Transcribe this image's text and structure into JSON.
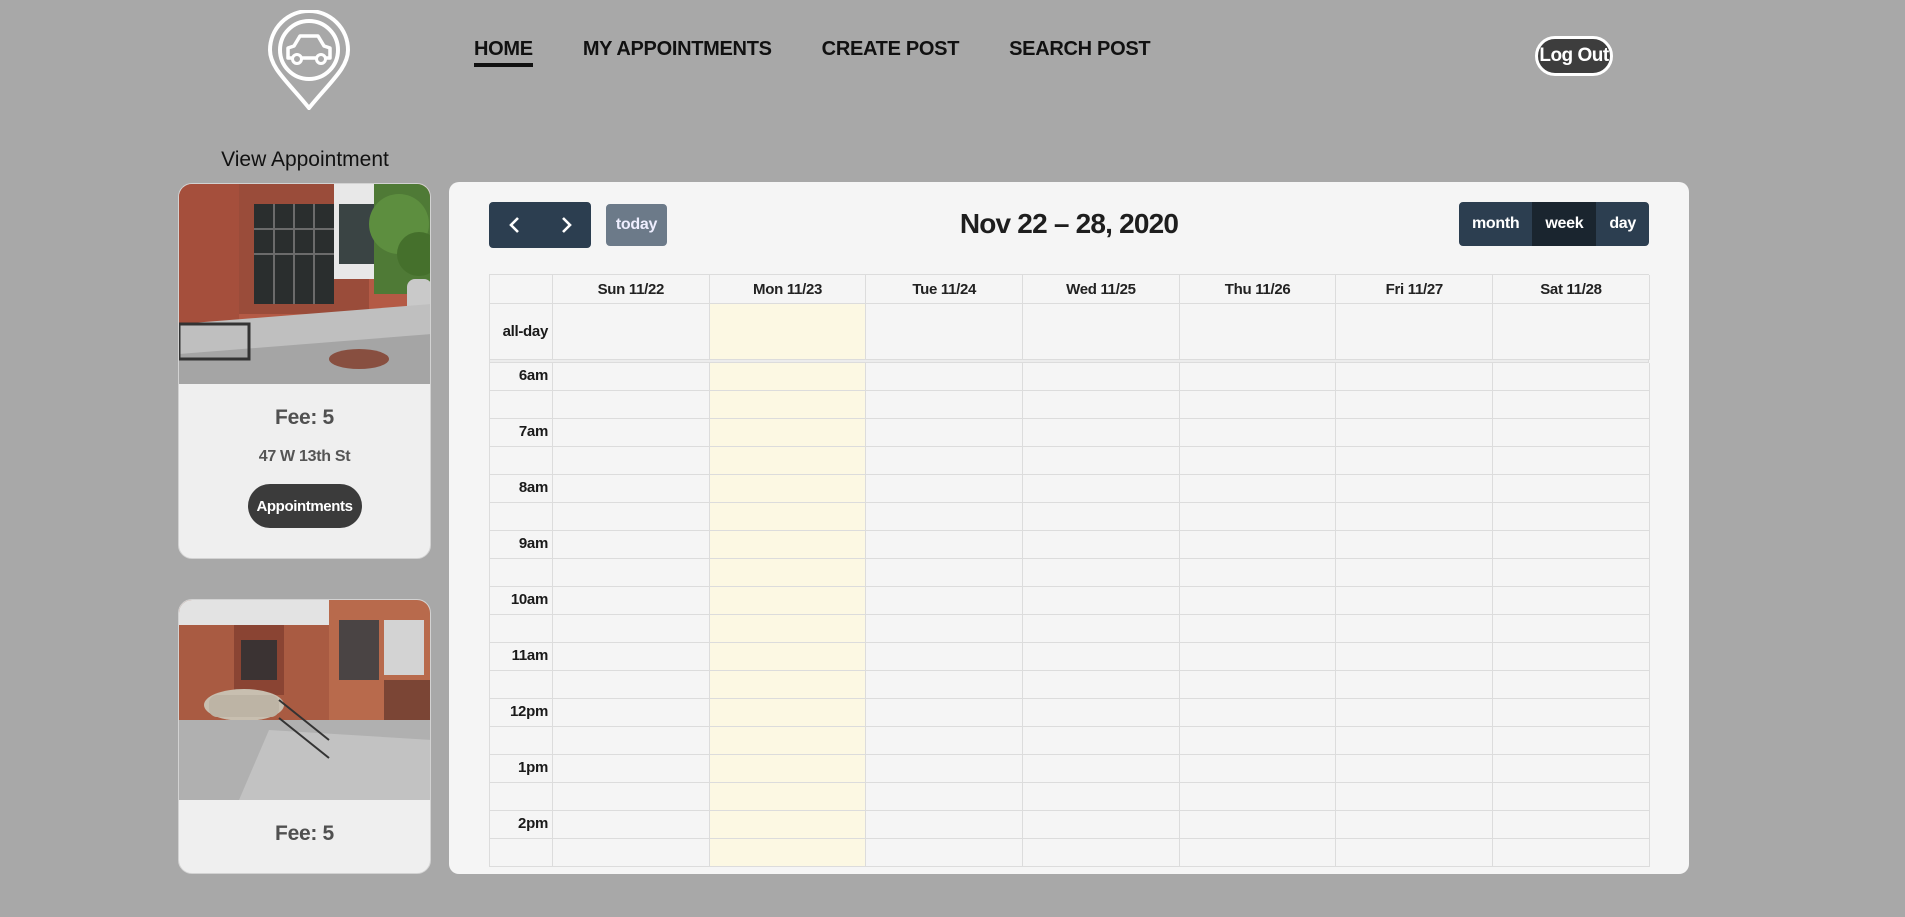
{
  "header": {
    "nav": [
      {
        "label": "HOME",
        "active": true
      },
      {
        "label": "MY APPOINTMENTS",
        "active": false
      },
      {
        "label": "CREATE POST",
        "active": false
      },
      {
        "label": "SEARCH POST",
        "active": false
      }
    ],
    "logout_label": "Log Out",
    "logo_icon": "car-location-pin-icon"
  },
  "sidebar": {
    "title": "View Appointment",
    "cards": [
      {
        "fee": "Fee: 5",
        "address": "47 W 13th St",
        "button": "Appointments"
      },
      {
        "fee": "Fee: 5",
        "address": "",
        "button": ""
      }
    ]
  },
  "calendar": {
    "title": "Nov 22 – 28, 2020",
    "prev_icon": "chevron-left-icon",
    "next_icon": "chevron-right-icon",
    "today_label": "today",
    "views": [
      {
        "label": "month",
        "active": false
      },
      {
        "label": "week",
        "active": true
      },
      {
        "label": "day",
        "active": false
      }
    ],
    "days": [
      "Sun 11/22",
      "Mon 11/23",
      "Tue 11/24",
      "Wed 11/25",
      "Thu 11/26",
      "Fri 11/27",
      "Sat 11/28"
    ],
    "today_index": 1,
    "allday_label": "all-day",
    "hours": [
      "6am",
      "7am",
      "8am",
      "9am",
      "10am",
      "11am",
      "12pm",
      "1pm",
      "2pm"
    ]
  },
  "colors": {
    "background": "#a8a8a8",
    "toolbar_button": "#2c3e50",
    "today_highlight": "#fcf8e3"
  }
}
